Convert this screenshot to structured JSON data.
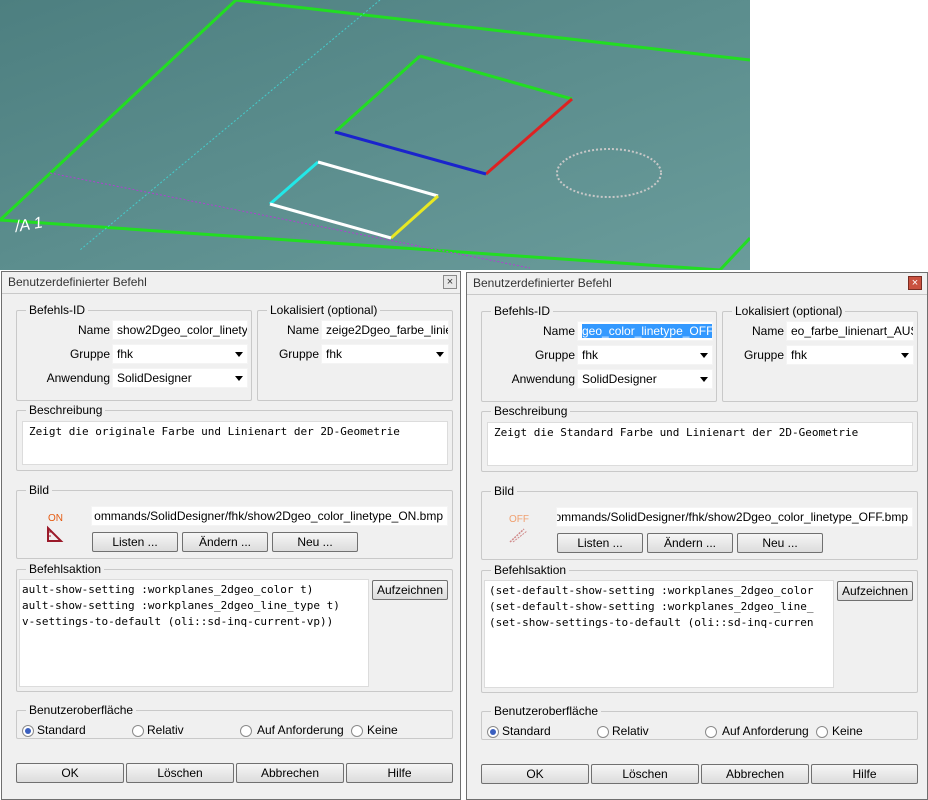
{
  "viewport": {
    "label": "/A 1",
    "colors": {
      "background": "#5f8e8f",
      "green": "#22dd22",
      "red": "#dd2222",
      "blue": "#1a24cc",
      "cyan": "#22e8e8",
      "yellow": "#e8e822",
      "white": "#ffffff",
      "magenta": "#b040d0"
    }
  },
  "dialogs": [
    {
      "title": "Benutzerdefinierter Befehl",
      "close": "×",
      "befehls_id": {
        "legend": "Befehls-ID",
        "name_label": "Name",
        "name_value": "show2Dgeo_color_linety",
        "gruppe_label": "Gruppe",
        "gruppe_value": "fhk",
        "anwendung_label": "Anwendung",
        "anwendung_value": "SolidDesigner"
      },
      "lokalisiert": {
        "legend": "Lokalisiert (optional)",
        "name_label": "Name",
        "name_value": "zeige2Dgeo_farbe_linie",
        "gruppe_label": "Gruppe",
        "gruppe_value": "fhk"
      },
      "beschreibung": {
        "legend": "Beschreibung",
        "text": "Zeigt die originale Farbe und Linienart der 2D-Geometrie"
      },
      "bild": {
        "legend": "Bild",
        "icon_text": "ON",
        "icon_name": "on-ruler-icon",
        "path": "ommands/SolidDesigner/fhk/show2Dgeo_color_linetype_ON.bmp",
        "listen": "Listen ...",
        "aendern": "Ändern ...",
        "neu": "Neu ..."
      },
      "aktion": {
        "legend": "Befehlsaktion",
        "record": "Aufzeichnen",
        "lines": [
          "ault-show-setting :workplanes_2dgeo_color t)",
          "ault-show-setting :workplanes_2dgeo_line_type t)",
          "v-settings-to-default (oli::sd-inq-current-vp))"
        ]
      },
      "ui": {
        "legend": "Benutzeroberfläche",
        "standard": "Standard",
        "relativ": "Relativ",
        "auf_anforderung": "Auf Anforderung",
        "keine": "Keine",
        "selected": "Standard"
      },
      "buttons": {
        "ok": "OK",
        "loeschen": "Löschen",
        "abbrechen": "Abbrechen",
        "hilfe": "Hilfe"
      }
    },
    {
      "title": "Benutzerdefinierter Befehl",
      "close": "×",
      "befehls_id": {
        "legend": "Befehls-ID",
        "name_label": "Name",
        "name_value": "geo_color_linetype_OFF",
        "gruppe_label": "Gruppe",
        "gruppe_value": "fhk",
        "anwendung_label": "Anwendung",
        "anwendung_value": "SolidDesigner"
      },
      "lokalisiert": {
        "legend": "Lokalisiert (optional)",
        "name_label": "Name",
        "name_value": "eo_farbe_linienart_AUS",
        "gruppe_label": "Gruppe",
        "gruppe_value": "fhk"
      },
      "beschreibung": {
        "legend": "Beschreibung",
        "text": "Zeigt die Standard Farbe und Linienart der 2D-Geometrie"
      },
      "bild": {
        "legend": "Bild",
        "icon_text": "OFF",
        "icon_name": "off-ruler-icon",
        "path": "ommands/SolidDesigner/fhk/show2Dgeo_color_linetype_OFF.bmp",
        "listen": "Listen ...",
        "aendern": "Ändern ...",
        "neu": "Neu ..."
      },
      "aktion": {
        "legend": "Befehlsaktion",
        "record": "Aufzeichnen",
        "lines": [
          "(set-default-show-setting :workplanes_2dgeo_color",
          "(set-default-show-setting :workplanes_2dgeo_line_",
          "(set-show-settings-to-default (oli::sd-inq-curren"
        ]
      },
      "ui": {
        "legend": "Benutzeroberfläche",
        "standard": "Standard",
        "relativ": "Relativ",
        "auf_anforderung": "Auf Anforderung",
        "keine": "Keine",
        "selected": "Standard"
      },
      "buttons": {
        "ok": "OK",
        "loeschen": "Löschen",
        "abbrechen": "Abbrechen",
        "hilfe": "Hilfe"
      }
    }
  ]
}
